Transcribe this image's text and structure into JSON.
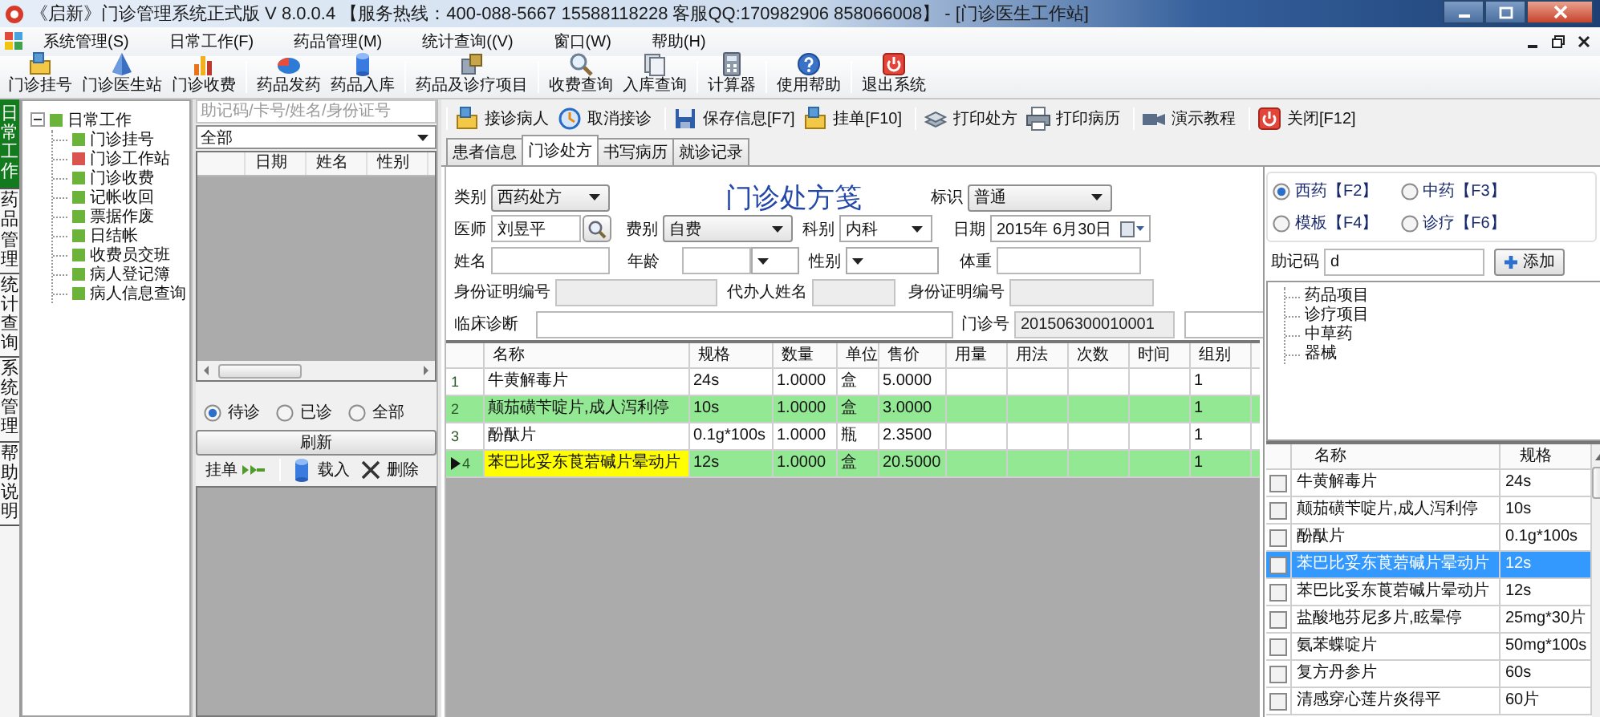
{
  "window": {
    "title": "《启新》门诊管理系统正式版 V 8.0.0.4 【服务热线：400-088-5667 15588118228 客服QQ:170982906 858066008】 - [门诊医生工作站]"
  },
  "menu": [
    "系统管理(S)",
    "日常工作(F)",
    "药品管理(M)",
    "统计查询((V)",
    "窗口(W)",
    "帮助(H)"
  ],
  "toolbar": [
    [
      {
        "label": "门诊挂号",
        "kind": "register"
      },
      {
        "label": "门诊医生站",
        "kind": "doctor"
      },
      {
        "label": "门诊收费",
        "kind": "cash"
      }
    ],
    [
      {
        "label": "药品发药",
        "kind": "dispense"
      },
      {
        "label": "药品入库",
        "kind": "stockin"
      }
    ],
    [
      {
        "label": "药品及诊疗项目",
        "kind": "items"
      }
    ],
    [
      {
        "label": "收费查询",
        "kind": "query"
      },
      {
        "label": "入库查询",
        "kind": "stockquery"
      }
    ],
    [
      {
        "label": "计算器",
        "kind": "calculator"
      }
    ],
    [
      {
        "label": "使用帮助",
        "kind": "help"
      }
    ],
    [
      {
        "label": "退出系统",
        "kind": "exit"
      }
    ]
  ],
  "side_tabs": [
    {
      "label": "日常工作",
      "selected": true
    },
    {
      "label": "药品管理",
      "selected": false
    },
    {
      "label": "统计查询",
      "selected": false
    },
    {
      "label": "系统管理",
      "selected": false
    },
    {
      "label": "帮助说明",
      "selected": false
    }
  ],
  "tree": {
    "label": "日常工作",
    "expanded": true,
    "children": [
      {
        "label": "门诊挂号",
        "color": "#6bb33a"
      },
      {
        "label": "门诊工作站",
        "color": "#d9534f"
      },
      {
        "label": "门诊收费",
        "color": "#6bb33a"
      },
      {
        "label": "记帐收回",
        "color": "#6bb33a"
      },
      {
        "label": "票据作废",
        "color": "#6bb33a"
      },
      {
        "label": "日结帐",
        "color": "#6bb33a"
      },
      {
        "label": "收费员交班",
        "color": "#6bb33a"
      },
      {
        "label": "病人登记簿",
        "color": "#6bb33a"
      },
      {
        "label": "病人信息查询",
        "color": "#6bb33a"
      }
    ]
  },
  "patient_list": {
    "search": {
      "placeholder": "助记码/卡号/姓名/身份证号"
    },
    "filter": "全部",
    "columns": [
      "日期",
      "姓名",
      "性别"
    ],
    "status_options": [
      {
        "label": "待诊",
        "selected": true
      },
      {
        "label": "已诊",
        "selected": false
      },
      {
        "label": "全部",
        "selected": false
      }
    ],
    "refresh_button": "刷新",
    "actions": [
      {
        "label": "挂单",
        "kind": "hold"
      },
      {
        "label": "载入",
        "kind": "load"
      },
      {
        "label": "删除",
        "kind": "delete"
      }
    ]
  },
  "work_toolbar": [
    [
      {
        "label": "接诊病人",
        "kind": "receive"
      },
      {
        "label": "取消接诊",
        "kind": "cancel"
      }
    ],
    [
      {
        "label": "保存信息[F7]",
        "kind": "save"
      },
      {
        "label": "挂单[F10]",
        "kind": "receive"
      }
    ],
    [
      {
        "label": "打印处方",
        "kind": "printstack"
      },
      {
        "label": "打印病历",
        "kind": "printer"
      }
    ],
    [
      {
        "label": "演示教程",
        "kind": "video"
      }
    ],
    [
      {
        "label": "关闭[F12]",
        "kind": "exit"
      }
    ]
  ],
  "tabs": [
    {
      "label": "患者信息",
      "selected": false
    },
    {
      "label": "门诊处方",
      "selected": true
    },
    {
      "label": "书写病历",
      "selected": false
    },
    {
      "label": "就诊记录",
      "selected": false
    }
  ],
  "prescription": {
    "title": "门诊处方笺",
    "category": {
      "label": "类别",
      "value": "西药处方"
    },
    "mark": {
      "label": "标识",
      "value": "普通"
    },
    "doctor": {
      "label": "医师",
      "value": "刘昱平"
    },
    "fee_type": {
      "label": "费别",
      "value": "自费"
    },
    "department": {
      "label": "科别",
      "value": "内科"
    },
    "date": {
      "label": "日期",
      "value": "2015年 6月30日"
    },
    "name": {
      "label": "姓名",
      "disabled": false
    },
    "age": {
      "label": "年龄",
      "disabled": false
    },
    "sex": {
      "label": "性别"
    },
    "weight": {
      "label": "体重",
      "disabled": false
    },
    "id_number": {
      "label": "身份证明编号",
      "disabled": true
    },
    "agent_name": {
      "label": "代办人姓名",
      "disabled": true
    },
    "agent_id_number": {
      "label": "身份证明编号",
      "disabled": true
    },
    "diagnosis": {
      "label": "临床诊断",
      "disabled": false
    },
    "visit_number": {
      "label": "门诊号",
      "value": "201506300010001",
      "disabled": true
    }
  },
  "table": {
    "columns": [
      "名称",
      "规格",
      "数量",
      "单位",
      "售价",
      "用量",
      "用法",
      "次数",
      "时间",
      "组别"
    ],
    "rows": [
      {
        "number": "1",
        "name": "牛黄解毒片",
        "spec": "24s",
        "quantity": "1.0000",
        "unit": "盒",
        "price": "5.0000",
        "group": "1",
        "highlighted": false,
        "selected": false
      },
      {
        "number": "2",
        "name": "颠茄磺苄啶片,成人泻利停",
        "spec": "10s",
        "quantity": "1.0000",
        "unit": "盒",
        "price": "3.0000",
        "group": "1",
        "highlighted": true,
        "selected": false
      },
      {
        "number": "3",
        "name": "酚酞片",
        "spec": "0.1g*100s",
        "quantity": "1.0000",
        "unit": "瓶",
        "price": "2.3500",
        "group": "1",
        "highlighted": false,
        "selected": false
      },
      {
        "number": "4",
        "name": "苯巴比妥东莨菪碱片晕动片",
        "spec": "12s",
        "quantity": "1.0000",
        "unit": "盒",
        "price": "20.5000",
        "group": "1",
        "highlighted": true,
        "selected": true
      }
    ]
  },
  "drug_source": [
    {
      "label": "西药【F2】",
      "selected": true
    },
    {
      "label": "中药【F3】",
      "selected": false
    },
    {
      "label": "模板【F4】",
      "selected": false
    },
    {
      "label": "诊疗【F6】",
      "selected": false
    }
  ],
  "mnemonic": {
    "label": "助记码",
    "value": "d"
  },
  "add_button": "添加",
  "category_tree": [
    "药品项目",
    "诊疗项目",
    "中草药",
    "器械"
  ],
  "drug_list": {
    "columns": [
      "名称",
      "规格"
    ],
    "rows": [
      {
        "name": "牛黄解毒片",
        "spec": "24s",
        "checked": false,
        "selected": false
      },
      {
        "name": "颠茄磺苄啶片,成人泻利停",
        "spec": "10s",
        "checked": false,
        "selected": false
      },
      {
        "name": "酚酞片",
        "spec": "0.1g*100s",
        "checked": false,
        "selected": false
      },
      {
        "name": "苯巴比妥东莨菪碱片晕动片",
        "spec": "12s",
        "checked": false,
        "selected": true
      },
      {
        "name": "苯巴比妥东莨菪碱片晕动片",
        "spec": "12s",
        "checked": false,
        "selected": false
      },
      {
        "name": "盐酸地芬尼多片,眩晕停",
        "spec": "25mg*30片",
        "checked": false,
        "selected": false
      },
      {
        "name": "氨苯蝶啶片",
        "spec": "50mg*100s",
        "checked": false,
        "selected": false
      },
      {
        "name": "复方丹参片",
        "spec": "60s",
        "checked": false,
        "selected": false
      },
      {
        "name": "清感穿心莲片炎得平",
        "spec": "60片",
        "checked": false,
        "selected": false
      }
    ]
  }
}
